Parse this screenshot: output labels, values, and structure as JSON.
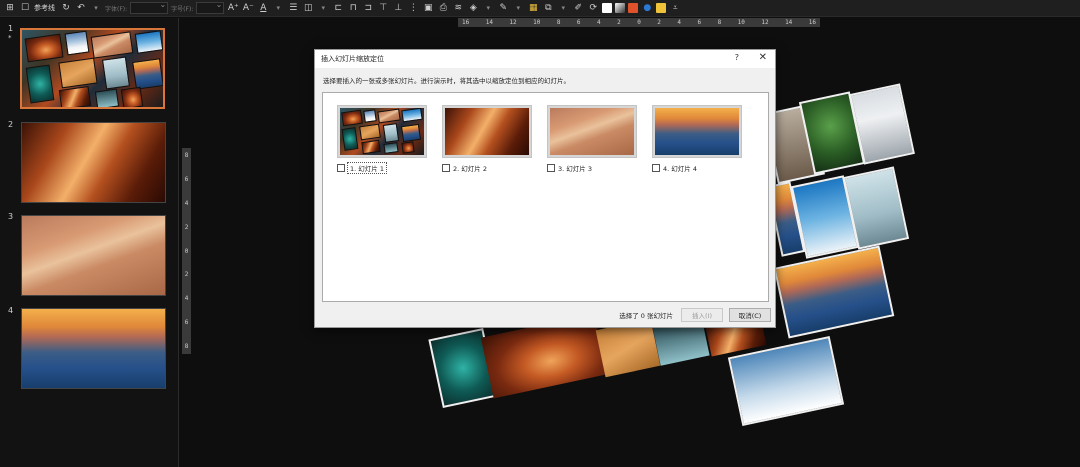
{
  "toolbar": {
    "reference_lines_label": "参考线",
    "font_label": "字体(F):",
    "font_size_label": "字号(F):",
    "font_grow_icon": "A⁺",
    "font_shrink_icon": "A⁻",
    "clear_format_icon": "A",
    "colors": {
      "square_white": "#ffffff",
      "square_gradient": "#bfbfbf",
      "accent_orange": "#e0522a",
      "accent_blue": "#2b78d6",
      "accent_yellow": "#f0c23a"
    }
  },
  "ruler": {
    "horizontal": [
      "16",
      "14",
      "12",
      "10",
      "8",
      "6",
      "4",
      "2",
      "0",
      "2",
      "4",
      "6",
      "8",
      "10",
      "12",
      "14",
      "16"
    ],
    "vertical": [
      "8",
      "6",
      "4",
      "2",
      "0",
      "2",
      "4",
      "6",
      "8"
    ]
  },
  "slides": [
    {
      "number": "1",
      "marker": "*"
    },
    {
      "number": "2"
    },
    {
      "number": "3"
    },
    {
      "number": "4"
    }
  ],
  "dialog": {
    "title": "插入幻灯片缩放定位",
    "help": "?",
    "close": "✕",
    "instruction": "选择要插入的一张或多张幻灯片。进行演示时，将其选中以缩放定位到相应的幻灯片。",
    "options": [
      {
        "label": "1. 幻灯片 1"
      },
      {
        "label": "2. 幻灯片 2"
      },
      {
        "label": "3. 幻灯片 3"
      },
      {
        "label": "4. 幻灯片 4"
      }
    ],
    "status": "选择了 0 张幻灯片",
    "insert_button": "插入(I)",
    "cancel_button": "取消(C)"
  }
}
